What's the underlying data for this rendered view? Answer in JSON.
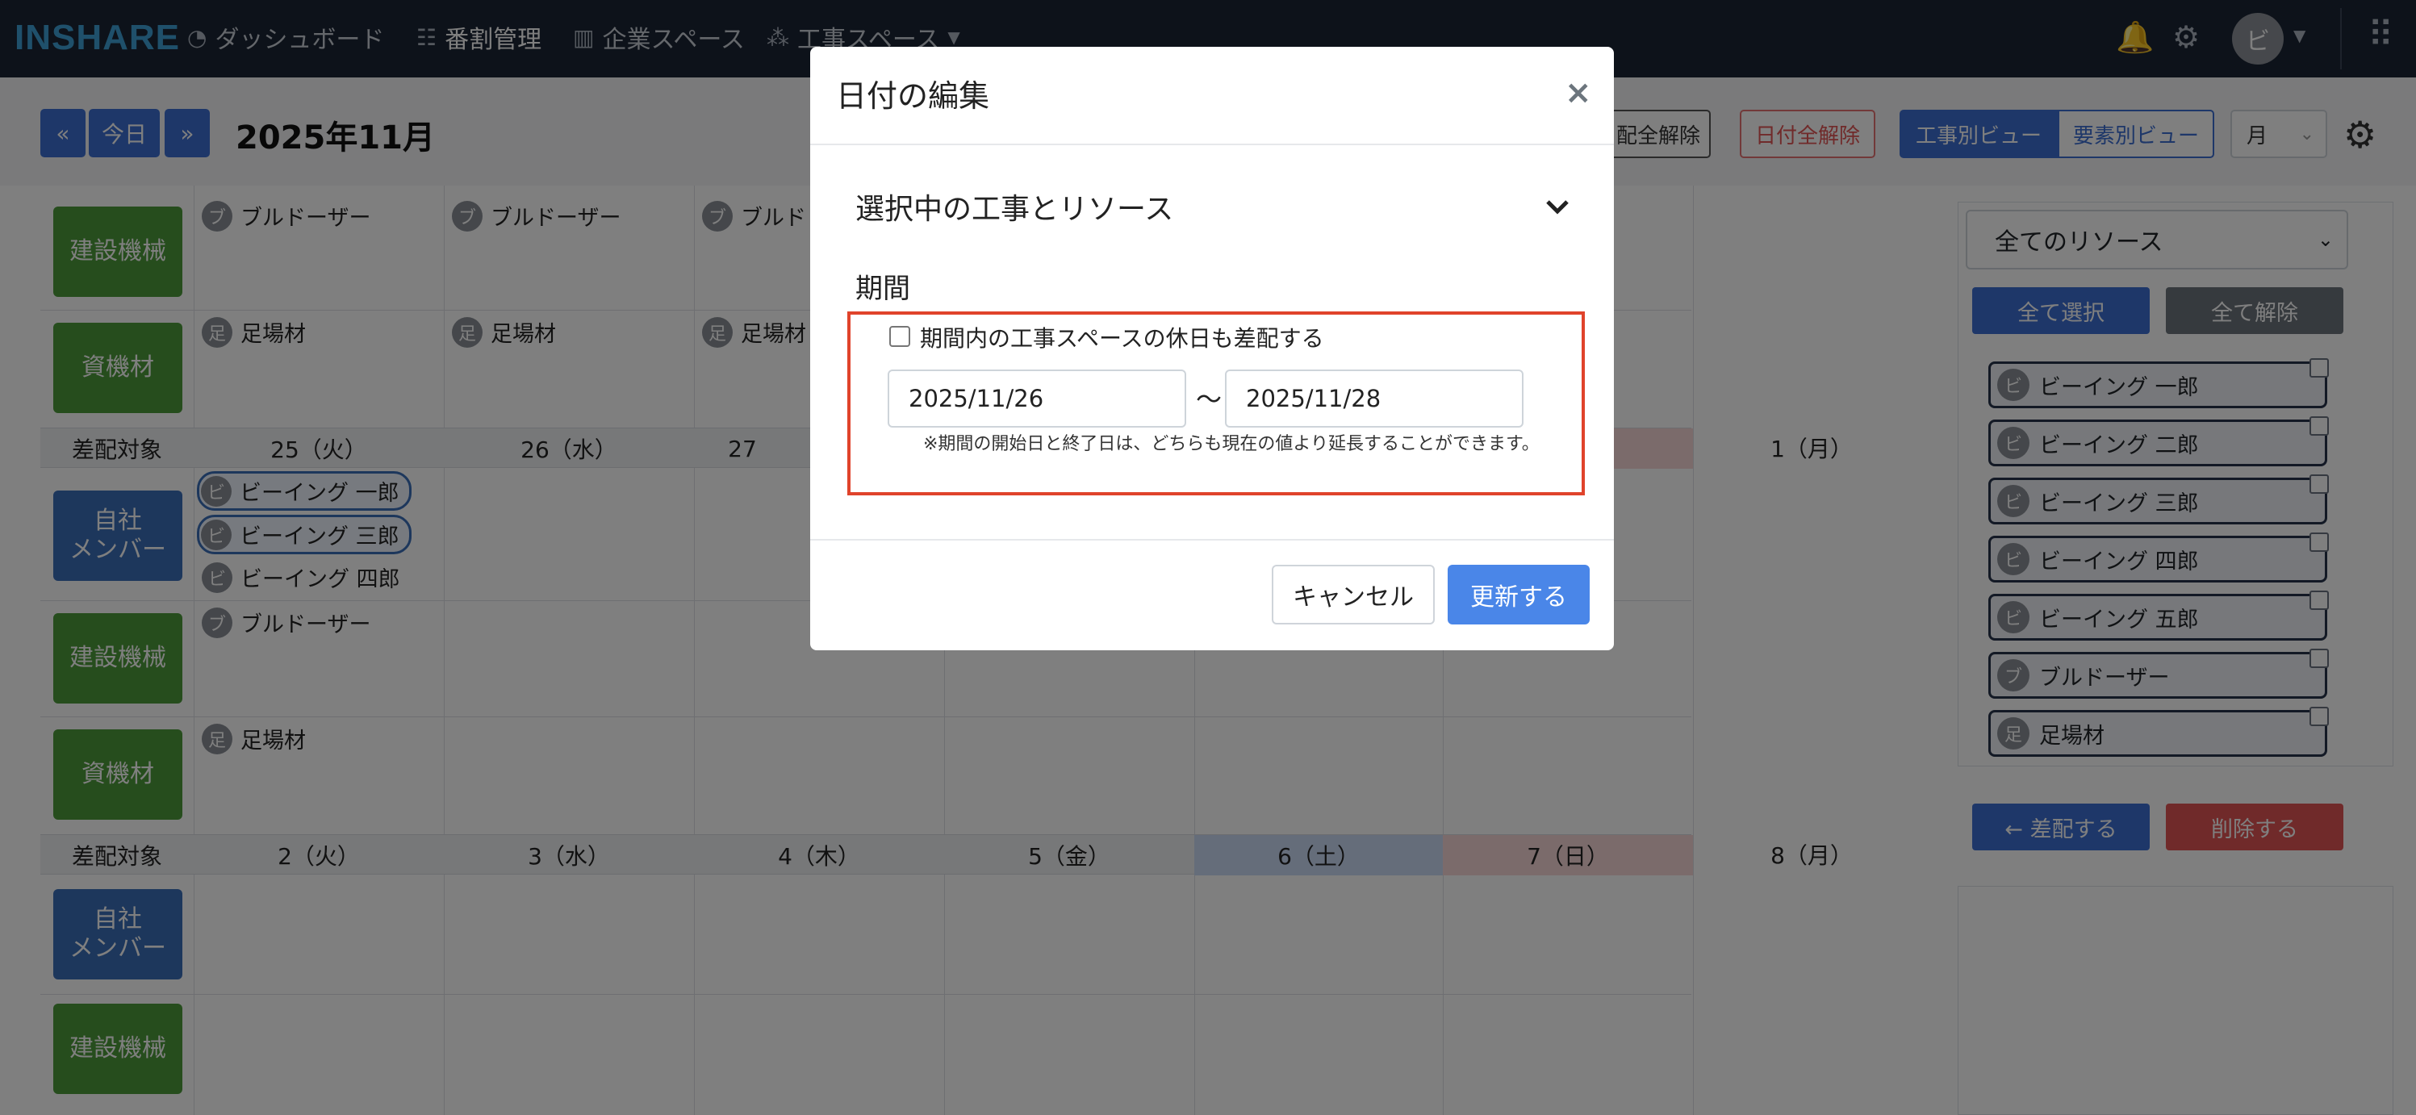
{
  "nav": {
    "logo": "INSHARE",
    "items": [
      {
        "label": "ダッシュボード",
        "icon": "dashboard-icon"
      },
      {
        "label": "番割管理",
        "icon": "list-icon"
      },
      {
        "label": "企業スペース",
        "icon": "building-icon"
      },
      {
        "label": "工事スペース",
        "icon": "group-icon"
      }
    ],
    "avatar": "ビ"
  },
  "toolbar": {
    "prev": "«",
    "today": "今日",
    "next": "»",
    "month": "2025年11月",
    "clear_assign": "配全解除",
    "clear_dates": "日付全解除",
    "view_project": "工事別ビュー",
    "view_element": "要素別ビュー",
    "period_select": "月"
  },
  "calendar": {
    "row_labels": {
      "machine": "建設機械",
      "material": "資機材",
      "member": "自社\nメンバー",
      "target": "差配対象"
    },
    "week1_headers": [
      "25（火）",
      "26（水）",
      "27",
      "",
      "",
      "",
      "1（月）"
    ],
    "week2_headers": [
      "2（火）",
      "3（水）",
      "4（木）",
      "5（金）",
      "6（土）",
      "7（日）",
      "8（月）"
    ],
    "chips": {
      "bulldozer": "ブルドーザー",
      "bulldozer_short": "ブルド",
      "scaffold": "足場材",
      "scaffold_short": "足場材",
      "ichiro": "ビーイング 一郎",
      "saburo": "ビーイング 三郎",
      "shiro": "ビーイング 四郎",
      "b_initial": "ブ",
      "a_initial": "足",
      "bi_initial": "ビ"
    }
  },
  "side": {
    "resource_select": "全てのリソース",
    "select_all": "全て選択",
    "deselect_all": "全て解除",
    "resources": [
      {
        "initial": "ビ",
        "name": "ビーイング 一郎"
      },
      {
        "initial": "ビ",
        "name": "ビーイング 二郎"
      },
      {
        "initial": "ビ",
        "name": "ビーイング 三郎"
      },
      {
        "initial": "ビ",
        "name": "ビーイング 四郎"
      },
      {
        "initial": "ビ",
        "name": "ビーイング 五郎"
      },
      {
        "initial": "ブ",
        "name": "ブルドーザー"
      },
      {
        "initial": "足",
        "name": "足場材"
      }
    ],
    "assign": "← 差配する",
    "delete": "削除する"
  },
  "modal": {
    "title": "日付の編集",
    "close": "×",
    "section": "選択中の工事とリソース",
    "period_label": "期間",
    "holiday_checkbox": "期間内の工事スペースの休日も差配する",
    "start_date": "2025/11/26",
    "tilde": "〜",
    "end_date": "2025/11/28",
    "note": "※期間の開始日と終了日は、どちらも現在の値より延長することができます。",
    "cancel": "キャンセル",
    "update": "更新する"
  }
}
